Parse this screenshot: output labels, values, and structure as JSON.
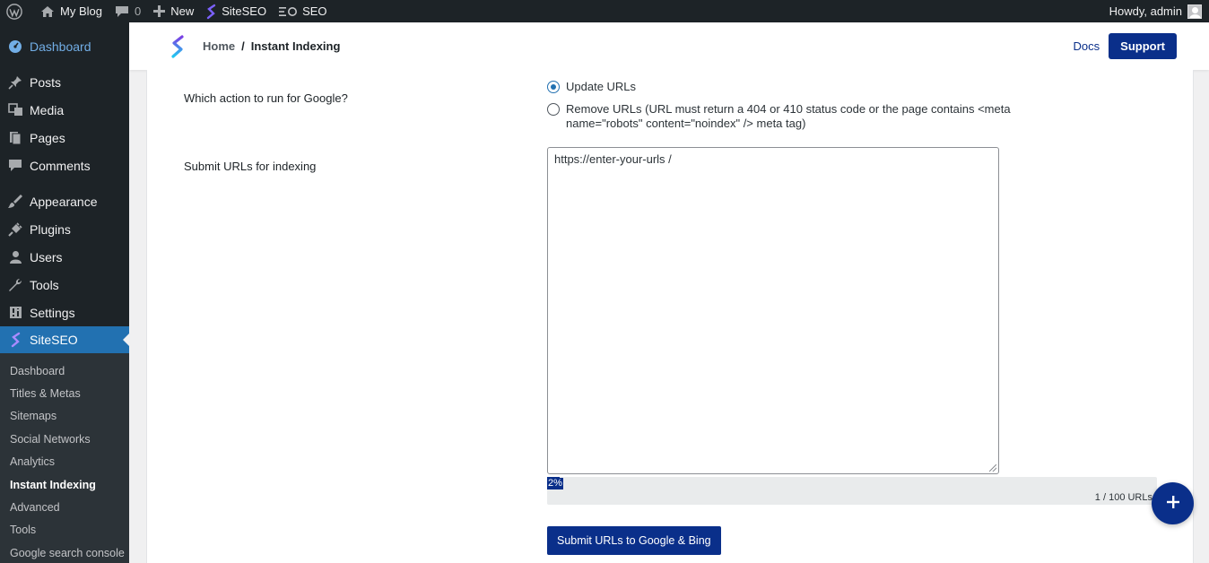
{
  "adminbar": {
    "site_name": "My Blog",
    "comments_count": "0",
    "new_label": "New",
    "siteseo_label": "SiteSEO",
    "seo_label": "SEO",
    "greeting": "Howdy, admin"
  },
  "sidebar": {
    "items": [
      {
        "label": "Dashboard",
        "icon": "dashboard-icon"
      },
      {
        "label": "Posts",
        "icon": "pin-icon"
      },
      {
        "label": "Media",
        "icon": "media-icon"
      },
      {
        "label": "Pages",
        "icon": "pages-icon"
      },
      {
        "label": "Comments",
        "icon": "comment-icon"
      },
      {
        "label": "Appearance",
        "icon": "brush-icon"
      },
      {
        "label": "Plugins",
        "icon": "plug-icon"
      },
      {
        "label": "Users",
        "icon": "user-icon"
      },
      {
        "label": "Tools",
        "icon": "wrench-icon"
      },
      {
        "label": "Settings",
        "icon": "settings-icon"
      },
      {
        "label": "SiteSEO",
        "icon": "siteseo-icon"
      }
    ],
    "submenu": [
      "Dashboard",
      "Titles & Metas",
      "Sitemaps",
      "Social Networks",
      "Analytics",
      "Instant Indexing",
      "Advanced",
      "Tools",
      "Google search console"
    ]
  },
  "topbar": {
    "breadcrumb_home": "Home",
    "breadcrumb_sep": "/",
    "breadcrumb_current": "Instant Indexing",
    "docs_label": "Docs",
    "support_label": "Support"
  },
  "form": {
    "action_label": "Which action to run for Google?",
    "option_update": "Update URLs",
    "option_remove": "Remove URLs (URL must return a 404 or 410 status code or the page contains <meta name=\"robots\" content=\"noindex\" /> meta tag)",
    "urls_label": "Submit URLs for indexing",
    "urls_value": "https://enter-your-urls /",
    "progress_percent": 2,
    "progress_text": "2%",
    "count_text": "1 / 100 URLs",
    "submit_label": "Submit URLs to Google & Bing"
  },
  "colors": {
    "primary": "#0a2f8a",
    "wp_admin_bg": "#1d2327",
    "active_menu": "#2271b1"
  }
}
